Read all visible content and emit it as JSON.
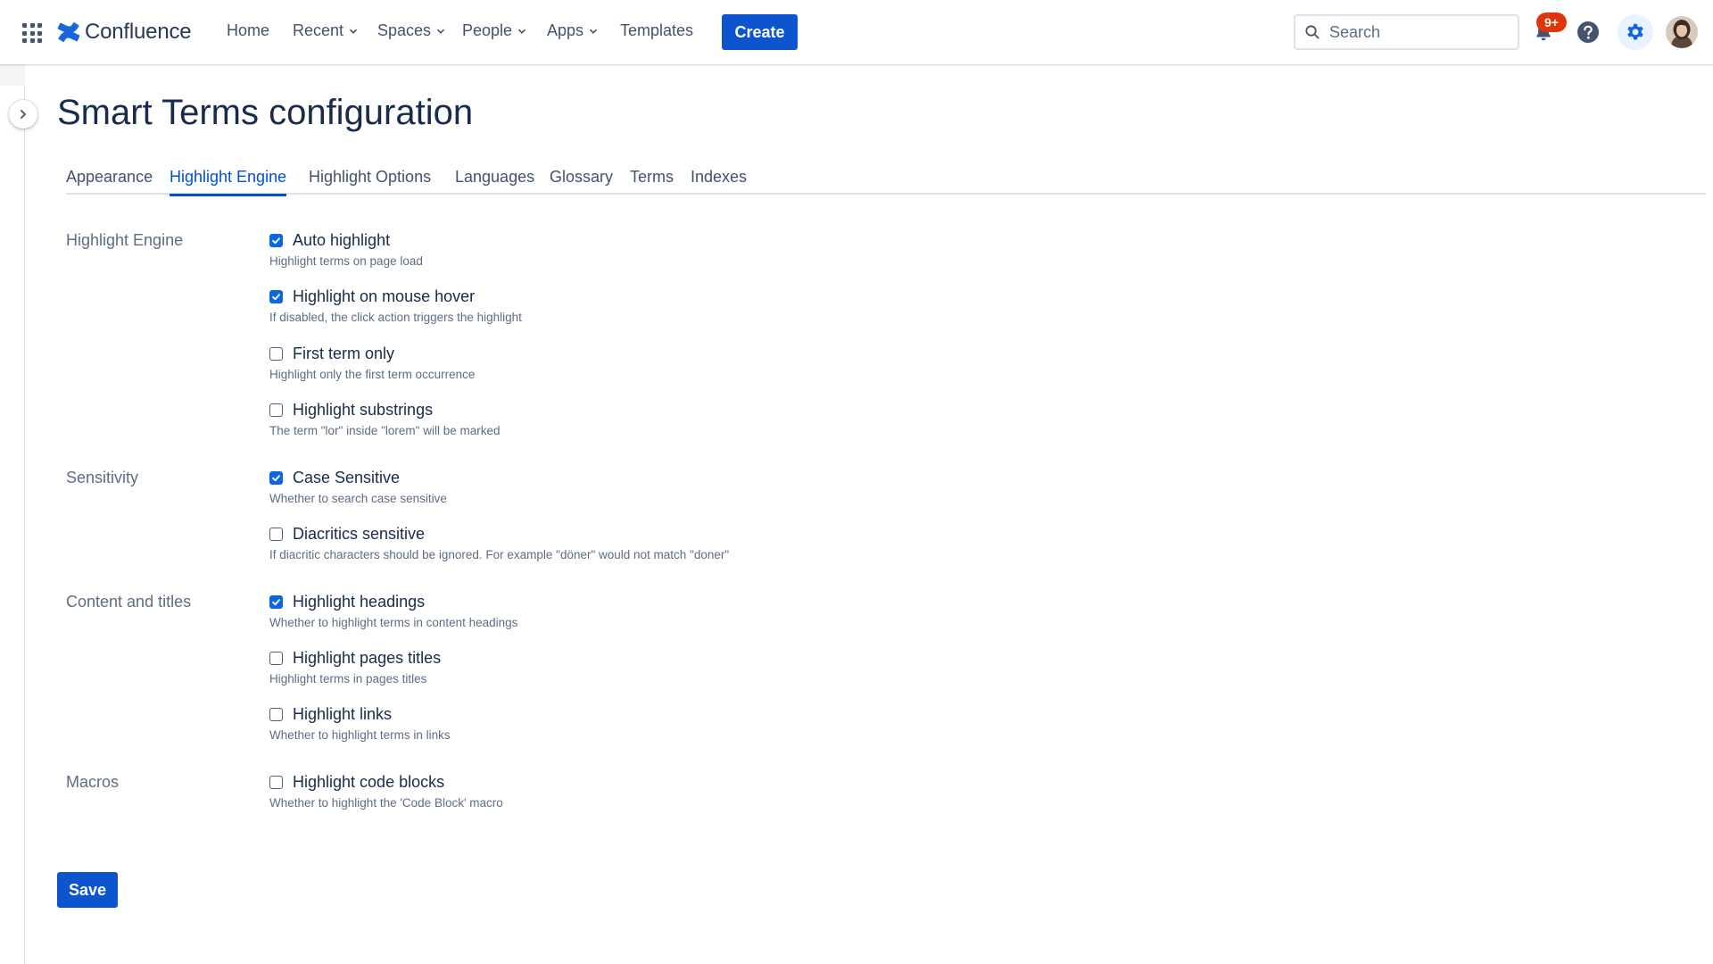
{
  "header": {
    "brand": "Confluence",
    "nav": [
      {
        "label": "Home",
        "has_menu": false
      },
      {
        "label": "Recent",
        "has_menu": true
      },
      {
        "label": "Spaces",
        "has_menu": true
      },
      {
        "label": "People",
        "has_menu": true
      },
      {
        "label": "Apps",
        "has_menu": true
      },
      {
        "label": "Templates",
        "has_menu": false
      }
    ],
    "create_label": "Create",
    "search": {
      "placeholder": "Search",
      "value": ""
    },
    "notifications_badge": "9+",
    "icons": {
      "app_switcher": "grid-icon",
      "notifications": "bell-icon",
      "help": "help-icon",
      "settings": "gear-icon",
      "avatar": "user-avatar"
    },
    "accent_color": "#0c55cf"
  },
  "page": {
    "title": "Smart Terms configuration",
    "tabs": [
      {
        "label": "Appearance",
        "active": false
      },
      {
        "label": "Highlight Engine",
        "active": true
      },
      {
        "label": "Highlight Options",
        "active": false
      },
      {
        "label": "Languages",
        "active": false
      },
      {
        "label": "Glossary",
        "active": false
      },
      {
        "label": "Terms",
        "active": false
      },
      {
        "label": "Indexes",
        "active": false
      }
    ],
    "groups": [
      {
        "label": "Highlight Engine",
        "options": [
          {
            "label": "Auto highlight",
            "description": "Highlight terms on page load",
            "checked": true
          },
          {
            "label": "Highlight on mouse hover",
            "description": "If disabled, the click action triggers the highlight",
            "checked": true
          },
          {
            "label": "First term only",
            "description": "Highlight only the first term occurrence",
            "checked": false
          },
          {
            "label": "Highlight substrings",
            "description": "The term \"lor\" inside \"lorem\" will be marked",
            "checked": false
          }
        ]
      },
      {
        "label": "Sensitivity",
        "options": [
          {
            "label": "Case Sensitive",
            "description": "Whether to search case sensitive",
            "checked": true
          },
          {
            "label": "Diacritics sensitive",
            "description": "If diacritic characters should be ignored. For example \"döner\" would not match \"doner\"",
            "checked": false
          }
        ]
      },
      {
        "label": "Content and titles",
        "options": [
          {
            "label": "Highlight headings",
            "description": "Whether to highlight terms in content headings",
            "checked": true
          },
          {
            "label": "Highlight pages titles",
            "description": "Highlight terms in pages titles",
            "checked": false
          },
          {
            "label": "Highlight links",
            "description": "Whether to highlight terms in links",
            "checked": false
          }
        ]
      },
      {
        "label": "Macros",
        "options": [
          {
            "label": "Highlight code blocks",
            "description": "Whether to highlight the 'Code Block' macro",
            "checked": false
          }
        ]
      }
    ],
    "save_label": "Save"
  }
}
